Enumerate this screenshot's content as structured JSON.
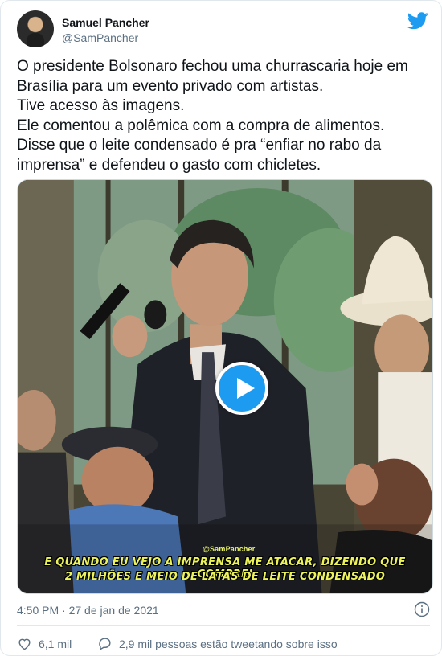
{
  "author": {
    "name": "Samuel Pancher",
    "handle": "@SamPancher"
  },
  "tweet": {
    "text": "O presidente Bolsonaro fechou uma churrascaria hoje em Brasília para um evento privado com artistas.\nTive acesso às imagens.\nEle comentou a polêmica com a compra de alimentos. Disse que o leite condensado é pra “enfiar no rabo da imprensa” e defendeu o gasto com chicletes."
  },
  "video": {
    "watermark": "@SamPancher",
    "subtitle_line1": "E QUANDO EU VEJO A IMPRENSA ME ATACAR, DIZENDO QUE COMPREI",
    "subtitle_line2": "2 MILHÕES E MEIO DE LATAS DE LEITE CONDENSADO",
    "play_icon": "play-icon"
  },
  "meta": {
    "timestamp": "4:50 PM · 27 de jan de 2021"
  },
  "actions": {
    "likes": "6,1 mil",
    "replies": "2,9 mil pessoas estão tweetando sobre isso"
  },
  "colors": {
    "twitter_blue": "#1d9bf0",
    "secondary_text": "#5b7083",
    "subtitle_yellow": "#ecf25c"
  }
}
